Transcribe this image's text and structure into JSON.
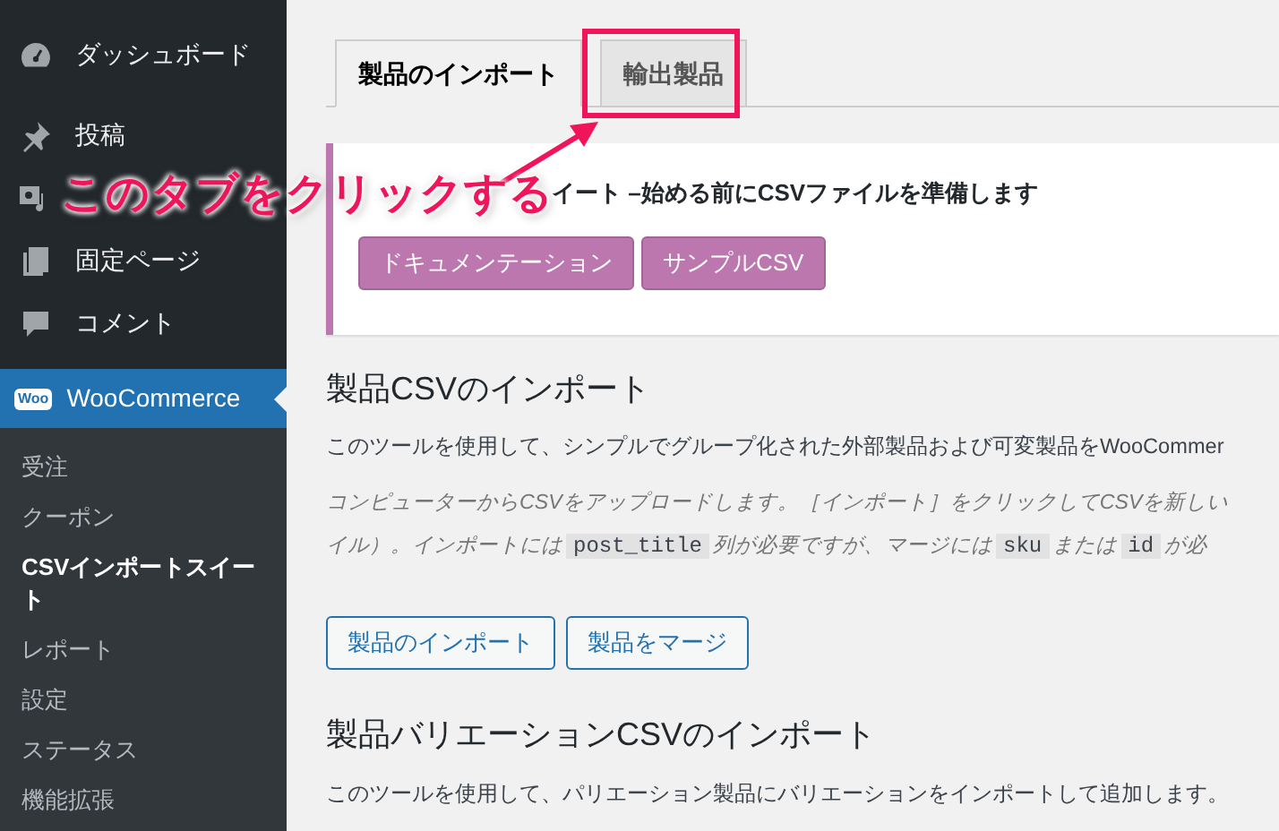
{
  "sidebar": {
    "items": [
      {
        "kind": "dashboard",
        "label": "ダッシュボード",
        "selected": false
      },
      {
        "kind": "pin",
        "label": "投稿",
        "selected": false
      },
      {
        "kind": "media",
        "selected": false
      },
      {
        "kind": "pages",
        "label": "固定ページ",
        "selected": false
      },
      {
        "kind": "comment",
        "label": "コメント",
        "selected": false
      },
      {
        "kind": "woo",
        "label": "WooCommerce",
        "selected": true,
        "logo": "Woo"
      }
    ],
    "submenu": [
      {
        "label": "受注",
        "selected": false
      },
      {
        "label": "クーポン",
        "selected": false
      },
      {
        "label": "CSVインポートスイート",
        "selected": true
      },
      {
        "label": "レポート",
        "selected": false
      },
      {
        "label": "設定",
        "selected": false
      },
      {
        "label": "ステータス",
        "selected": false
      },
      {
        "label": "機能拡張",
        "selected": false
      }
    ]
  },
  "tabs": [
    {
      "label": "製品のインポート",
      "selected": true
    },
    {
      "label": "輸出製品",
      "selected": false
    }
  ],
  "notice": {
    "text": "イート –始める前にCSVファイルを準備します",
    "buttons": [
      "ドキュメンテーション",
      "サンプルCSV"
    ]
  },
  "sections": [
    {
      "heading": "製品CSVのインポート",
      "intro": "このツールを使用して、シンプルでグループ化された外部製品および可変製品をWooCommer",
      "note_lines": [
        [
          {
            "kind": "text",
            "text": "コンピューターからCSVをアップロードします。［インポート］をクリックしてCSVを新しい"
          }
        ],
        [
          {
            "kind": "text",
            "text": "イル）。インポートには"
          },
          {
            "kind": "code",
            "text": "post_title"
          },
          {
            "kind": "text",
            "text": "列が必要ですが、マージには"
          },
          {
            "kind": "code",
            "text": "sku"
          },
          {
            "kind": "text",
            "text": "または"
          },
          {
            "kind": "code",
            "text": "id"
          },
          {
            "kind": "text",
            "text": "が必"
          }
        ]
      ],
      "buttons": [
        "製品のインポート",
        "製品をマージ"
      ]
    },
    {
      "heading": "製品バリエーションCSVのインポート",
      "intro": "このツールを使用して、パリエーション製品にバリエーションをインポートして追加します。"
    }
  ],
  "annotation": {
    "text": "このタブをクリックする"
  }
}
